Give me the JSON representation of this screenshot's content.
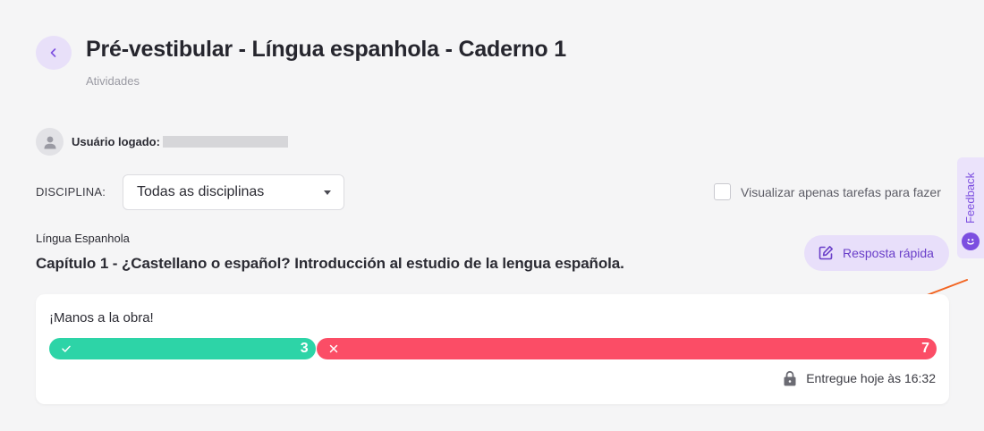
{
  "header": {
    "title": "Pré-vestibular - Língua espanhola - Caderno 1",
    "subtitle": "Atividades"
  },
  "user": {
    "label": "Usuário logado:"
  },
  "filters": {
    "discipline_label": "DISCIPLINA:",
    "discipline_selected": "Todas as disciplinas",
    "only_todo_label": "Visualizar apenas tarefas para fazer",
    "only_todo_checked": false
  },
  "feedback": {
    "label": "Feedback"
  },
  "activity": {
    "subject": "Língua Espanhola",
    "chapter": "Capítulo 1 - ¿Castellano o español? Introducción al estudio de la lengua española.",
    "quick_answer_label": "Resposta rápida"
  },
  "card": {
    "title": "¡Manos a la obra!",
    "correct_count": "3",
    "wrong_count": "7",
    "delivery_text": "Entregue hoje às 16:32"
  },
  "colors": {
    "accent": "#7c4fe0",
    "correct": "#2dd4a7",
    "wrong": "#fb4d66",
    "annotation_arrow": "#f26522"
  },
  "icons": {
    "back": "chevron-left-icon",
    "avatar": "user-icon",
    "dropdown": "caret-down-icon",
    "feedback": "smiley-icon",
    "quick_answer": "edit-icon",
    "correct": "check-icon",
    "wrong": "x-icon",
    "delivery": "lock-icon"
  }
}
